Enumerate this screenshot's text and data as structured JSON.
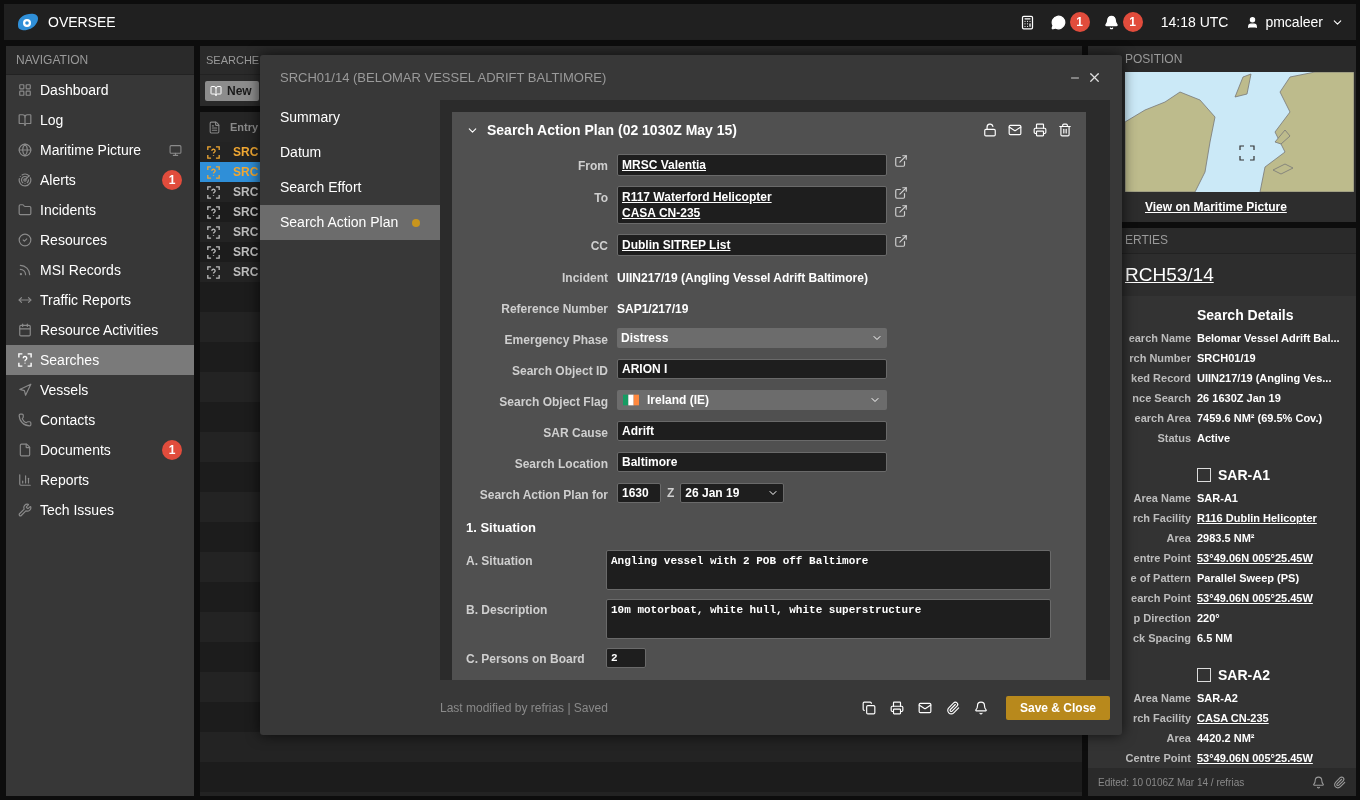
{
  "topbar": {
    "app_name": "OVERSEE",
    "chat_badge": "1",
    "alerts_badge": "1",
    "time": "14:18 UTC",
    "user": "pmcaleer"
  },
  "navigation": {
    "title": "NAVIGATION",
    "items": [
      {
        "label": "Dashboard",
        "selected": false
      },
      {
        "label": "Log",
        "selected": false
      },
      {
        "label": "Maritime Picture",
        "selected": false
      },
      {
        "label": "Alerts",
        "selected": false,
        "badge": "1"
      },
      {
        "label": "Incidents",
        "selected": false
      },
      {
        "label": "Resources",
        "selected": false
      },
      {
        "label": "MSI Records",
        "selected": false
      },
      {
        "label": "Traffic Reports",
        "selected": false
      },
      {
        "label": "Resource Activities",
        "selected": false
      },
      {
        "label": "Searches",
        "selected": true
      },
      {
        "label": "Vessels",
        "selected": false
      },
      {
        "label": "Contacts",
        "selected": false
      },
      {
        "label": "Documents",
        "selected": false,
        "badge": "1"
      },
      {
        "label": "Reports",
        "selected": false
      },
      {
        "label": "Tech Issues",
        "selected": false
      }
    ]
  },
  "searches": {
    "title": "SEARCHE",
    "new_button": "New",
    "column": "Entry",
    "rows": [
      {
        "text": "SRC",
        "flagged": true,
        "selected": false
      },
      {
        "text": "SRC",
        "flagged": true,
        "selected": true
      },
      {
        "text": "SRC",
        "flagged": false,
        "selected": false
      },
      {
        "text": "SRC",
        "flagged": false,
        "selected": false
      },
      {
        "text": "SRC",
        "flagged": false,
        "selected": false
      },
      {
        "text": "SRC",
        "flagged": false,
        "selected": false
      },
      {
        "text": "SRC",
        "flagged": false,
        "selected": false
      }
    ]
  },
  "dialog": {
    "title": "SRCH01/14 (BELOMAR VESSEL ADRIFT BALTIMORE)",
    "tabs": [
      {
        "label": "Summary",
        "selected": false,
        "unsaved": false
      },
      {
        "label": "Datum",
        "selected": false,
        "unsaved": false
      },
      {
        "label": "Search Effort",
        "selected": false,
        "unsaved": false
      },
      {
        "label": "Search Action Plan",
        "selected": true,
        "unsaved": true
      }
    ],
    "card_title": "Search Action Plan (02 1030Z May 15)",
    "fields": [
      {
        "kind": "links",
        "label": "From",
        "values": [
          "MRSC Valentia"
        ]
      },
      {
        "kind": "links",
        "label": "To",
        "values": [
          "R117 Waterford Helicopter",
          "CASA CN-235"
        ]
      },
      {
        "kind": "links",
        "label": "CC",
        "values": [
          "Dublin SITREP List"
        ]
      },
      {
        "kind": "text",
        "label": "Incident",
        "value": "UIIN217/19 (Angling Vessel Adrift Baltimore)"
      },
      {
        "kind": "text",
        "label": "Reference Number",
        "value": "SAP1/217/19"
      },
      {
        "kind": "select",
        "label": "Emergency Phase",
        "value": "Distress"
      },
      {
        "kind": "input",
        "label": "Search Object ID",
        "value": "ARION I"
      },
      {
        "kind": "flag",
        "label": "Search Object Flag",
        "value": "Ireland (IE)"
      },
      {
        "kind": "input",
        "label": "SAR Cause",
        "value": "Adrift"
      },
      {
        "kind": "input",
        "label": "Search Location",
        "value": "Baltimore"
      },
      {
        "kind": "datetime",
        "label": "Search Action Plan for",
        "time": "1630",
        "zone": "Z",
        "date": "26 Jan 19"
      }
    ],
    "section": {
      "heading": "1. Situation",
      "fields": [
        {
          "kind": "textarea",
          "label": "A. Situation",
          "value": "Angling vessel with 2 POB off Baltimore"
        },
        {
          "kind": "textarea",
          "label": "B. Description",
          "value": "10m motorboat, white hull, white superstructure"
        },
        {
          "kind": "short",
          "label": "C. Persons on Board",
          "value": "2"
        }
      ]
    },
    "status": "Last modified by refrias | Saved",
    "save_button": "Save & Close"
  },
  "position": {
    "title": "POSITION",
    "link": "View on Maritime Picture"
  },
  "properties": {
    "title": "ERTIES",
    "record": "RCH53/14",
    "groups": [
      {
        "kind": "heading",
        "title": "Search Details",
        "rows": [
          {
            "label": "earch Name",
            "value": "Belomar Vessel Adrift Bal...",
            "link": false
          },
          {
            "label": "rch Number",
            "value": "SRCH01/19",
            "link": false
          },
          {
            "label": "ked Record",
            "value": "UIIN217/19 (Angling Ves...",
            "link": false
          },
          {
            "label": "nce Search",
            "value": "26 1630Z Jan 19",
            "link": false
          },
          {
            "label": "earch Area",
            "value": "7459.6 NM² (69.5% Cov.)",
            "link": false
          },
          {
            "label": "Status",
            "value": "Active",
            "link": false
          }
        ]
      },
      {
        "kind": "checkbox",
        "title": "SAR-A1",
        "checked": false,
        "rows": [
          {
            "label": "Area Name",
            "value": "SAR-A1",
            "link": false
          },
          {
            "label": "rch Facility",
            "value": "R116 Dublin Helicopter",
            "link": true
          },
          {
            "label": "Area",
            "value": "2983.5 NM²",
            "link": false
          },
          {
            "label": "entre Point",
            "value": "53°49.06N 005°25.45W",
            "link": true
          },
          {
            "label": "e of Pattern",
            "value": "Parallel Sweep (PS)",
            "link": false
          },
          {
            "label": "earch Point",
            "value": "53°49.06N 005°25.45W",
            "link": true
          },
          {
            "label": "p Direction",
            "value": "220°",
            "link": false
          },
          {
            "label": "ck Spacing",
            "value": "6.5 NM",
            "link": false
          }
        ]
      },
      {
        "kind": "checkbox",
        "title": "SAR-A2",
        "checked": false,
        "rows": [
          {
            "label": "Area Name",
            "value": "SAR-A2",
            "link": false
          },
          {
            "label": "rch Facility",
            "value": "CASA CN-235",
            "link": true
          },
          {
            "label": "Area",
            "value": "4420.2 NM²",
            "link": false
          },
          {
            "label": "Centre Point",
            "value": "53°49.06N 005°25.45W",
            "link": true
          }
        ]
      }
    ],
    "footer": "Edited: 10 0106Z Mar 14 / refrias"
  }
}
